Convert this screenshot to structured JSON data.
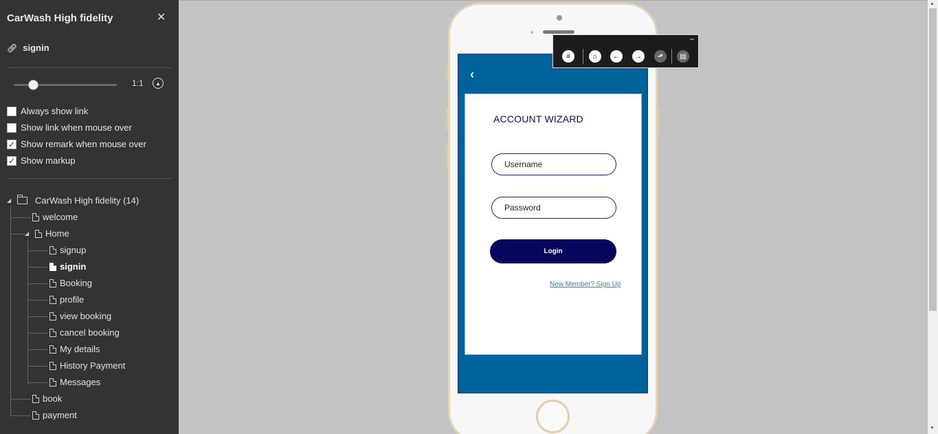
{
  "sidebar": {
    "title": "CarWash High fidelity",
    "close_icon": "close-icon",
    "current_page": "signin",
    "zoom_label": "1:1",
    "options": [
      {
        "label": "Always show link",
        "checked": false
      },
      {
        "label": "Show link when mouse over",
        "checked": false
      },
      {
        "label": "Show remark when mouse over",
        "checked": true
      },
      {
        "label": "Show markup",
        "checked": true
      }
    ],
    "tree": {
      "root": "CarWash High fidelity (14)",
      "items": [
        "welcome",
        "Home",
        "signup",
        "signin",
        "Booking",
        "profile",
        "view booking",
        "cancel booking",
        "My details",
        "History Payment",
        "Messages",
        "book",
        "payment"
      ]
    }
  },
  "toolbar": {
    "minimize": "–",
    "icons": [
      "menu-icon",
      "home-icon",
      "arrow-left-icon",
      "arrow-right-icon",
      "upload-icon",
      "document-icon"
    ]
  },
  "app": {
    "back": "‹",
    "title": "ACCOUNT WIZARD",
    "username_placeholder": "Username",
    "password_placeholder": "Password",
    "login_label": "Login",
    "signup_link": "New Member? Sign Up"
  },
  "colors": {
    "sidebar_bg": "#333333",
    "canvas_bg": "#c3c3c3",
    "app_header": "#00629b",
    "button": "#05055a",
    "link": "#1e88c8"
  }
}
